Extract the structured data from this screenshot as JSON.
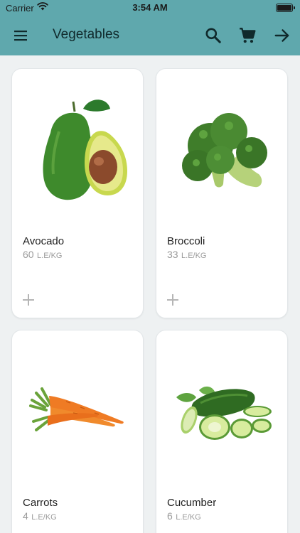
{
  "status_bar": {
    "carrier": "Carrier",
    "time": "3:54 AM",
    "battery": "full"
  },
  "toolbar": {
    "title": "Vegetables",
    "icons": [
      "menu-icon",
      "search-icon",
      "cart-icon",
      "arrow-right-icon"
    ]
  },
  "products": [
    {
      "name": "Avocado",
      "price": "60",
      "unit": "L.E/KG",
      "image": "avocado-image"
    },
    {
      "name": "Broccoli",
      "price": "33",
      "unit": "L.E/KG",
      "image": "broccoli-image"
    },
    {
      "name": "Carrots",
      "price": "4",
      "unit": "L.E/KG",
      "image": "carrots-image"
    },
    {
      "name": "Cucumber",
      "price": "6",
      "unit": "L.E/KG",
      "image": "cucumber-image"
    }
  ],
  "colors": {
    "header": "#5fa8ad",
    "background": "#eef1f2",
    "card": "#ffffff",
    "price_text": "#9a9a9a",
    "add_icon": "#b5b5b5"
  }
}
